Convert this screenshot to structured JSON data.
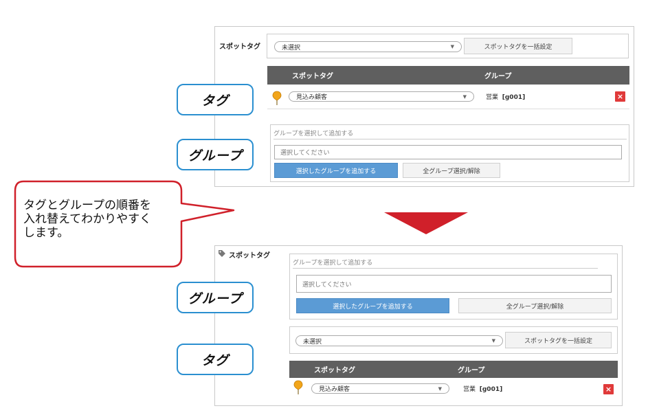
{
  "before": {
    "spot_tag_label": "スポットタグ",
    "select_value": "未選択",
    "bulk_button": "スポットタグを一括設定",
    "table": {
      "col_tag": "スポットタグ",
      "col_group": "グループ",
      "row": {
        "tag_value": "見込み顧客",
        "group_name": "営業",
        "group_code": "[g001]",
        "delete": "×"
      }
    },
    "group_section": {
      "title": "グループを選択して追加する",
      "input_placeholder": "選択してください",
      "add_button": "選択したグループを追加する",
      "toggle_button": "全グループ選択/解除"
    }
  },
  "after": {
    "spot_tag_label": "スポットタグ",
    "select_value": "未選択",
    "bulk_button": "スポットタグを一括設定",
    "table": {
      "col_tag": "スポットタグ",
      "col_group": "グループ",
      "row": {
        "tag_value": "見込み顧客",
        "group_name": "営業",
        "group_code": "[g001]",
        "delete": "×"
      }
    },
    "group_section": {
      "title": "グループを選択して追加する",
      "input_placeholder": "選択してください",
      "add_button": "選択したグループを追加する",
      "toggle_button": "全グループ選択/解除"
    }
  },
  "callouts": {
    "tag": "タグ",
    "group": "グループ"
  },
  "note": {
    "line1": "タグとグループの順番を",
    "line2": "入れ替えてわかりやすく",
    "line3": "します。"
  },
  "colors": {
    "callout_border": "#2a8fd0",
    "note_border": "#d0202a",
    "arrow": "#d0202a",
    "add_button": "#5b9bd5",
    "delete_button": "#e03a3a",
    "table_header": "#5f5f5f",
    "pin": "#f2a51a"
  }
}
